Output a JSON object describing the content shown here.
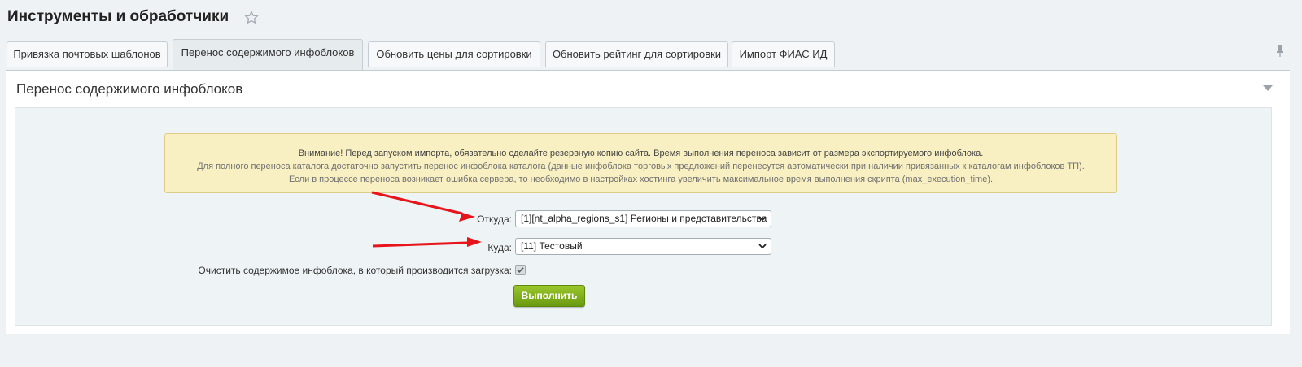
{
  "page": {
    "title": "Инструменты и обработчики"
  },
  "tabs": [
    {
      "label": "Привязка почтовых шаблонов"
    },
    {
      "label": "Перенос содержимого инфоблоков",
      "active": true
    },
    {
      "label": "Обновить цены для сортировки"
    },
    {
      "label": "Обновить рейтинг для сортировки"
    },
    {
      "label": "Импорт ФИАС ИД"
    }
  ],
  "panel": {
    "title": "Перенос содержимого инфоблоков"
  },
  "alert": {
    "line1": "Внимание! Перед запуском импорта, обязательно сделайте резервную копию сайта. Время выполнения переноса зависит от размера экспортируемого инфоблока.",
    "line2": "Для полного переноса каталога достаточно запустить перенос инфоблока каталога (данные инфоблока торговых предложений перенесутся автоматически при наличии привязанных к каталогам инфоблоков ТП).",
    "line3": "Если в процессе переноса возникает ошибка сервера, то необходимо в настройках хостинга увеличить максимальное время выполнения скрипта (max_execution_time)."
  },
  "form": {
    "from_label": "Откуда:",
    "from_value": "[1][nt_alpha_regions_s1] Регионы и представительства",
    "to_label": "Куда:",
    "to_value": "[11] Тестовый",
    "clear_label": "Очистить содержимое инфоблока, в который производится загрузка:",
    "clear_checked": true,
    "submit_label": "Выполнить"
  },
  "colors": {
    "submit": "#7aab16",
    "alert_bg": "#f8f0c2",
    "annotation_arrow": "#e8141b"
  },
  "icons": {
    "star": "star-icon",
    "pin": "pin-icon",
    "collapse": "collapse-triangle-icon",
    "select": "chevron-down-icon",
    "checkbox": "checkmark-icon"
  }
}
